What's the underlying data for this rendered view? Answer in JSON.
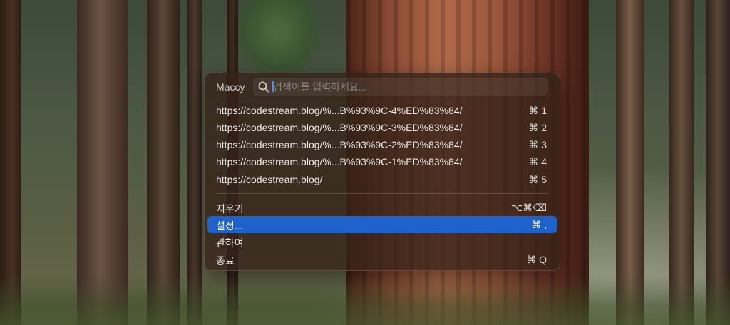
{
  "app": {
    "name": "Maccy"
  },
  "search": {
    "placeholder": "검색어를 입력하세요..."
  },
  "history": [
    {
      "text": "https://codestream.blog/%...B%93%9C-4%ED%83%84/",
      "shortcut": "⌘ 1"
    },
    {
      "text": "https://codestream.blog/%...B%93%9C-3%ED%83%84/",
      "shortcut": "⌘ 2"
    },
    {
      "text": "https://codestream.blog/%...B%93%9C-2%ED%83%84/",
      "shortcut": "⌘ 3"
    },
    {
      "text": "https://codestream.blog/%...B%93%9C-1%ED%83%84/",
      "shortcut": "⌘ 4"
    },
    {
      "text": "https://codestream.blog/",
      "shortcut": "⌘ 5"
    }
  ],
  "actions": [
    {
      "label": "지우기",
      "shortcut": "⌥⌘⌫"
    },
    {
      "label": "설정...",
      "shortcut": "⌘ ,"
    },
    {
      "label": "관하여",
      "shortcut": ""
    },
    {
      "label": "종료",
      "shortcut": "⌘ Q"
    }
  ],
  "selected_action": "설정...",
  "colors": {
    "selection": "#1f62cc",
    "panel": "#342218",
    "caret": "#4a8ff0"
  }
}
